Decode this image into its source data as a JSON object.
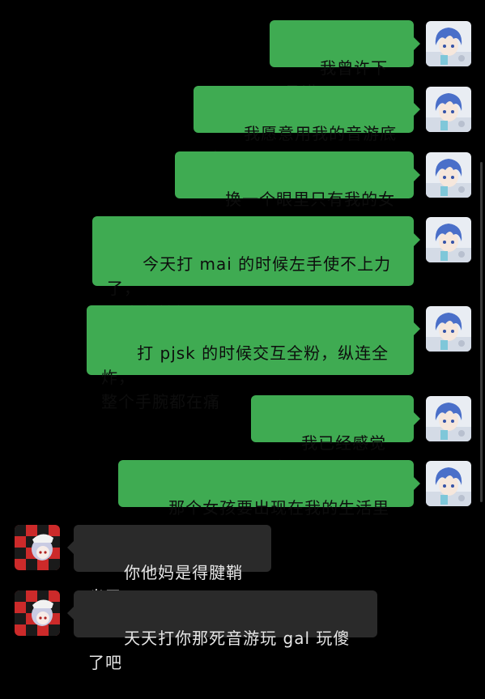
{
  "conversation": {
    "messages": [
      {
        "side": "out",
        "text": "我曾许下承诺"
      },
      {
        "side": "out",
        "text": "我愿意用我的音游底力"
      },
      {
        "side": "out",
        "text": "换一个眼里只有我的女孩"
      },
      {
        "side": "out",
        "text": "今天打 mai 的时候左手使不上力了，\n一直在拍框"
      },
      {
        "side": "out",
        "text": "打 pjsk 的时候交互全粉，纵连全炸，\n整个手腕都在痛"
      },
      {
        "side": "out",
        "text": "我已经感觉到了"
      },
      {
        "side": "out",
        "text": "那个女孩要出现在我的生活里了"
      },
      {
        "side": "in",
        "text": "你他妈是得腱鞘炎了"
      },
      {
        "side": "in",
        "text": "天天打你那死音游玩 gal 玩傻了吧"
      }
    ]
  },
  "avatars": {
    "self": {
      "icon": "anime-blue-hair-avatar-icon",
      "bg": "#e9edf3",
      "hair": "#4a6fc9"
    },
    "other": {
      "icon": "anime-checker-avatar-icon",
      "bg": "#cc2a2a",
      "hair": "#c9cbe3"
    }
  },
  "colors": {
    "outgoing_bubble": "#3fab52",
    "incoming_bubble": "#2a2a2a",
    "background": "#000000"
  }
}
